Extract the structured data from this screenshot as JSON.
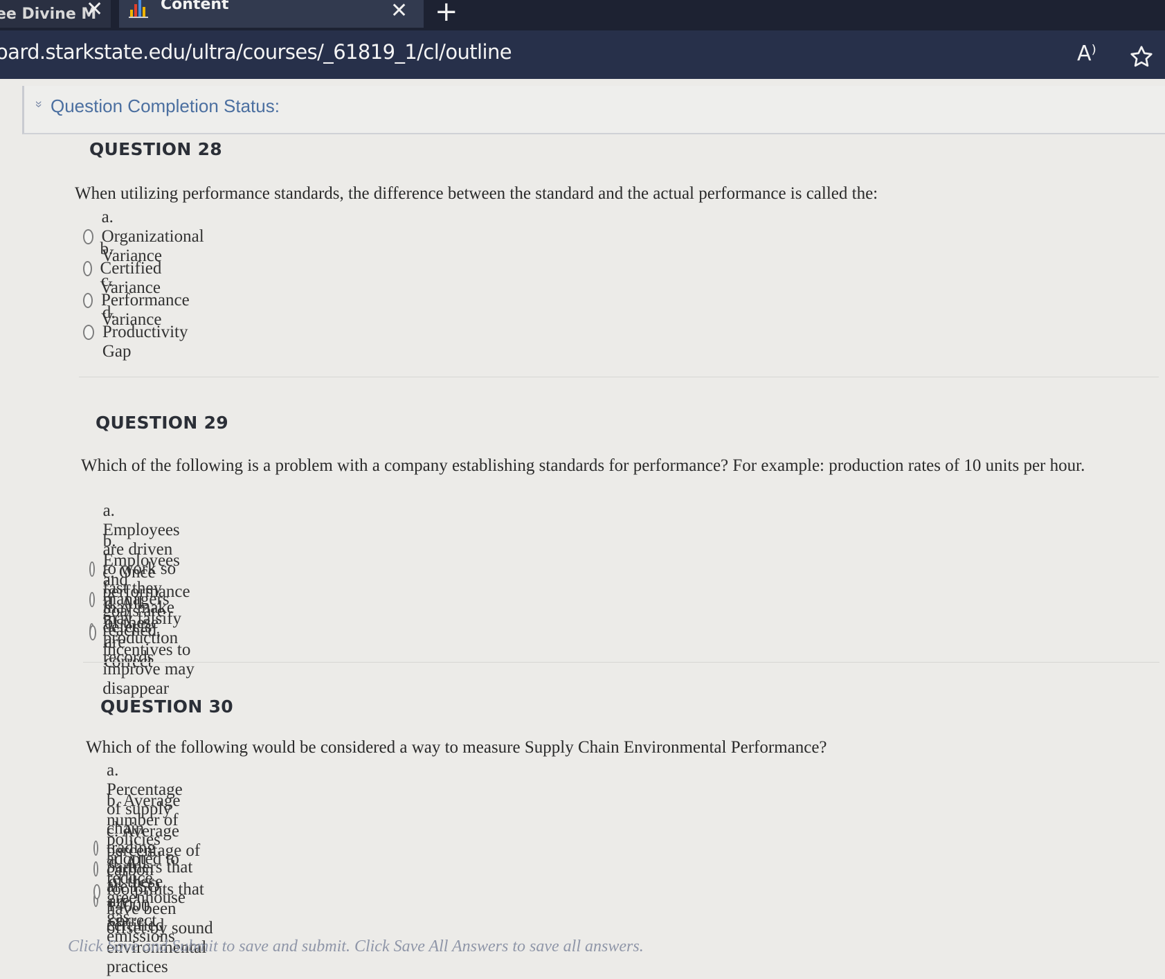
{
  "browser": {
    "tabs": [
      {
        "title": "ee Divine M",
        "active": false
      },
      {
        "title": "Content",
        "active": true
      }
    ],
    "url": "oard.starkstate.edu/ultra/courses/_61819_1/cl/outline",
    "icons": {
      "close": "close-icon",
      "new_tab": "plus-icon",
      "read_aloud": "read-aloud-icon",
      "favorite": "star-icon"
    },
    "glyphs": {
      "close": "✕",
      "plus": "+",
      "read_aloud": "A⁾"
    }
  },
  "status": {
    "label": "Question Completion Status:",
    "chevron": "»"
  },
  "questions": [
    {
      "heading": "QUESTION 28",
      "text": "When utilizing performance standards, the difference between the standard and the actual performance is called the:",
      "options": [
        "a. Organizational Variance",
        "b. Certified Variance",
        "c. Performance Variance",
        "d. Productivity Gap"
      ]
    },
    {
      "heading": "QUESTION 29",
      "text": "Which of the following is a problem with a company establishing standards for performance? For example: production rates of 10 units per hour.",
      "options": [
        "a. Employees are driven to work so fast they may make defects",
        "b. Employees and managers may falsify production records",
        "c. Once performance goals are reached, incentives to improve may disappear",
        "d. All of these are correct"
      ]
    },
    {
      "heading": "QUESTION 30",
      "text": "Which of the following would be considered a way to measure Supply Chain Environmental Performance?",
      "options": [
        "a. Percentage of supply chain trading partners that are ISO 14000 certified",
        "b. Average number of policies adopted to reduce greenhouse gas emissions",
        "c. Average percentage of carbon footprints that have been offset by sound environmental practices",
        "d. All of these are correct"
      ]
    }
  ],
  "footer": "Click Save and Submit to save and submit. Click Save All Answers to save all answers."
}
